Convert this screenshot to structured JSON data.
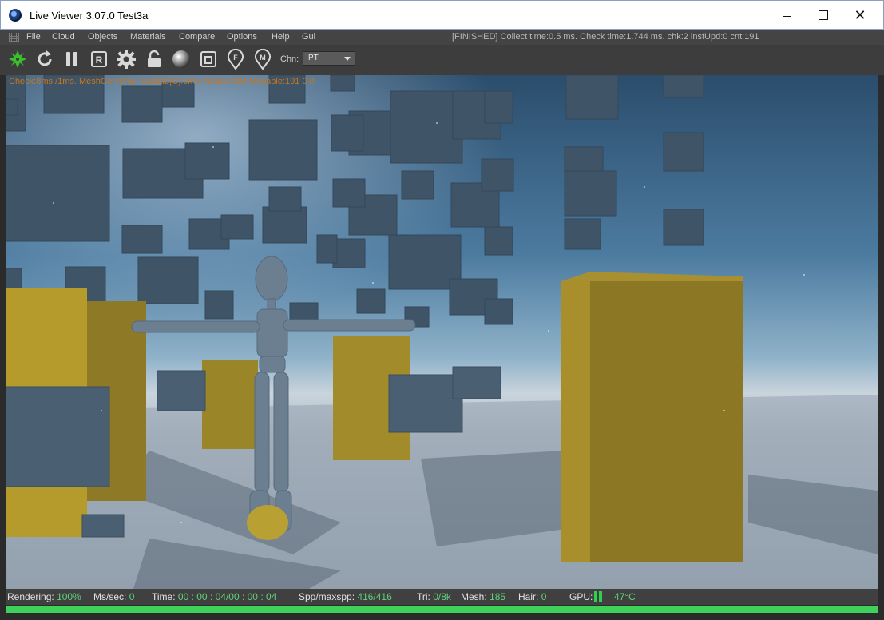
{
  "window": {
    "title": "Live Viewer 3.07.0 Test3a"
  },
  "menu": {
    "items": [
      "File",
      "Cloud",
      "Objects",
      "Materials",
      "Compare",
      "Options",
      "Help",
      "Gui"
    ],
    "status": "[FINISHED] Collect time:0.5 ms.  Check time:1.744 ms.  chk:2  instUpd:0  cnt:191"
  },
  "toolbar": {
    "icons": [
      "octane-icon",
      "refresh-icon",
      "pause-icon",
      "region-render-icon",
      "settings-icon",
      "lock-icon",
      "material-ball-icon",
      "frame-icon",
      "focus-pick-icon",
      "material-pick-icon"
    ],
    "channel_label": "Chn:",
    "channel_value": "PT"
  },
  "viewport": {
    "hud": "Check:8ms./1ms. MeshGen:0ms. Update[C]:0ms. Nodes:384 Movable:191  0 0"
  },
  "status": {
    "rendering_label": "Rendering:",
    "rendering_value": "100%",
    "ms_label": "Ms/sec:",
    "ms_value": "0",
    "time_label": "Time:",
    "time_value": "00 : 00 : 04/00 : 00 : 04",
    "spp_label": "Spp/maxspp:",
    "spp_value": "416/416",
    "tri_label": "Tri:",
    "tri_value": "0/8k",
    "mesh_label": "Mesh:",
    "mesh_value": "185",
    "hair_label": "Hair:",
    "hair_value": "0",
    "gpu_label": "GPU:",
    "gpu_temp": "47°C",
    "progress": 1.0
  },
  "colors": {
    "accent_green": "#3fd25b",
    "hud_orange": "#c8761c",
    "value_green": "#5fd37a"
  }
}
